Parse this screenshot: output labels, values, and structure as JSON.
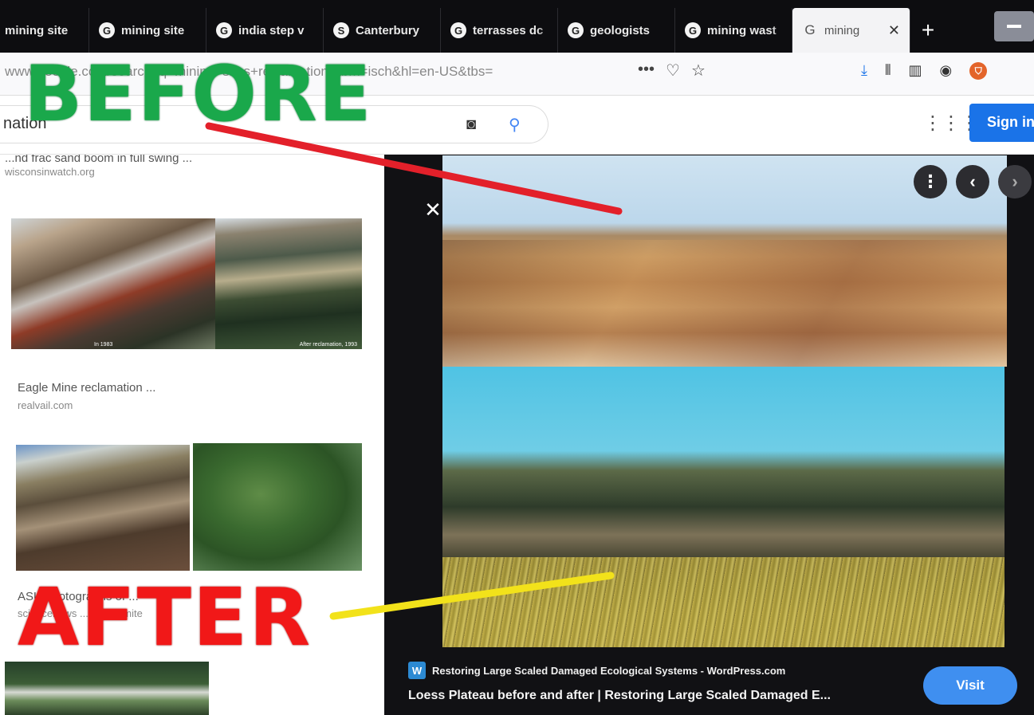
{
  "tabs": [
    {
      "label": "mining site",
      "icon": "google-icon"
    },
    {
      "label": "mining site",
      "icon": "google-icon"
    },
    {
      "label": "india step v",
      "icon": "google-icon"
    },
    {
      "label": "Canterbury",
      "icon": "s-site-icon"
    },
    {
      "label": "terrasses dc",
      "icon": "google-icon"
    },
    {
      "label": "geologists",
      "icon": "google-icon"
    },
    {
      "label": "mining wast",
      "icon": "google-icon"
    },
    {
      "label": "mining",
      "icon": "google-icon",
      "active": true
    }
  ],
  "url_bar": {
    "text": "www.google.com/search?q=mining+sites+reclamation&tbm=isch&hl=en-US&tbs="
  },
  "search": {
    "query_visible": "nation",
    "sign_in_label": "Sign in"
  },
  "results": [
    {
      "caption": "...nd frac sand boom in full swing ...",
      "source": "wisconsinwatch.org"
    },
    {
      "caption": "Eagle Mine reclamation ...",
      "source": "realvail.com",
      "thumb_left_label": "In 1983",
      "thumb_right_label": "After reclamation, 1993"
    },
    {
      "caption": "ASU photographs of ...",
      "source": "sciencenews ... ghana mite"
    }
  ],
  "preview": {
    "site": "Restoring Large Scaled Damaged Ecological Systems - WordPress.com",
    "title": "Loess Plateau before and after | Restoring Large Scaled Damaged E...",
    "visit_label": "Visit"
  },
  "annotations": {
    "before": "BEFORE",
    "after": "AFTER",
    "before_color": "#1aa84b",
    "after_color": "#f11818",
    "before_line_color": "#e3202a",
    "after_line_color": "#f2e21a"
  },
  "colors": {
    "google_blue": "#1a73e8",
    "visit_blue": "#3f8ff0"
  }
}
